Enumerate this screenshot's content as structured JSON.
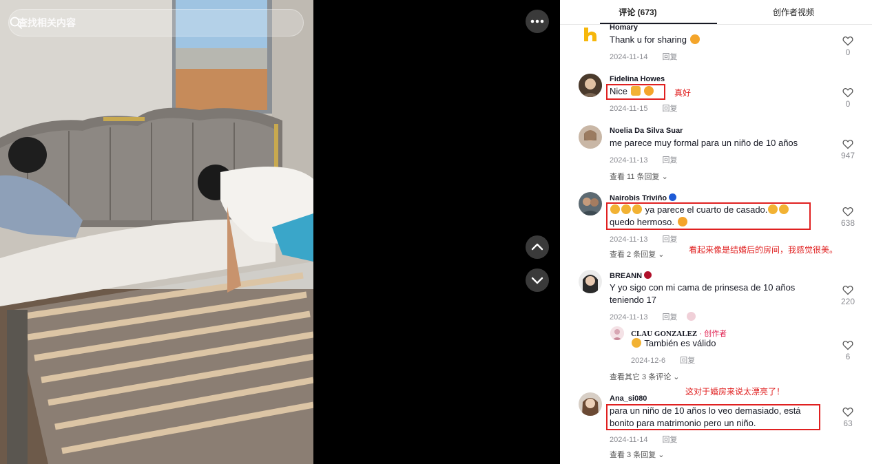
{
  "search": {
    "placeholder": "查找相关内容"
  },
  "tabs": [
    {
      "label": "评论 (673)",
      "active": true
    },
    {
      "label": "创作者视频",
      "active": false
    }
  ],
  "comments": [
    {
      "user": "Homary",
      "text": "Thank u for sharing",
      "date": "2024-11-14",
      "reply": "回复",
      "likes": "0"
    },
    {
      "user": "Fidelina Howes",
      "text": "Nice",
      "date": "2024-11-15",
      "reply": "回复",
      "likes": "0",
      "annotation": "真好"
    },
    {
      "user": "Noelia Da Silva Suar",
      "text": "me parece muy formal para un niño de 10 años",
      "date": "2024-11-13",
      "reply": "回复",
      "likes": "947",
      "more": "查看 11 条回复"
    },
    {
      "user": "Nairobis Triviño",
      "text_line1": "ya parece el cuarto de casado.",
      "text_line2": "quedo hermoso.",
      "date": "2024-11-13",
      "reply": "回复",
      "likes": "638",
      "more": "查看 2 条回复",
      "annotation": "看起来像是结婚后的房间，我感觉很美。"
    },
    {
      "user": "BREANN",
      "text": "Y yo sigo con mi cama de prinsesa de 10 años teniendo 17",
      "date": "2024-11-13",
      "reply": "回复",
      "likes": "220",
      "sub_reply": {
        "user": "CLAU GONZALEZ",
        "tag": "· 创作者",
        "text": "También es válido",
        "date": "2024-12-6",
        "reply": "回复",
        "likes": "6"
      },
      "more": "查看其它 3 条评论"
    },
    {
      "user": "Ana_si080",
      "text": "para un niño de 10 años lo veo demasiado, está bonito para matrimonio pero un niño.",
      "date": "2024-11-14",
      "reply": "回复",
      "likes": "63",
      "more": "查看 3 条回复",
      "annotation": "这对于婚房来说太漂亮了！"
    }
  ],
  "icons": {
    "search": "search-icon",
    "more": "more-dots-icon",
    "up": "chevron-up-icon",
    "down": "chevron-down-icon",
    "heart": "heart-outline-icon"
  },
  "colors": {
    "annotation_red": "#e02020",
    "creator_pink": "#e02050",
    "panel_bg": "#ffffff"
  }
}
